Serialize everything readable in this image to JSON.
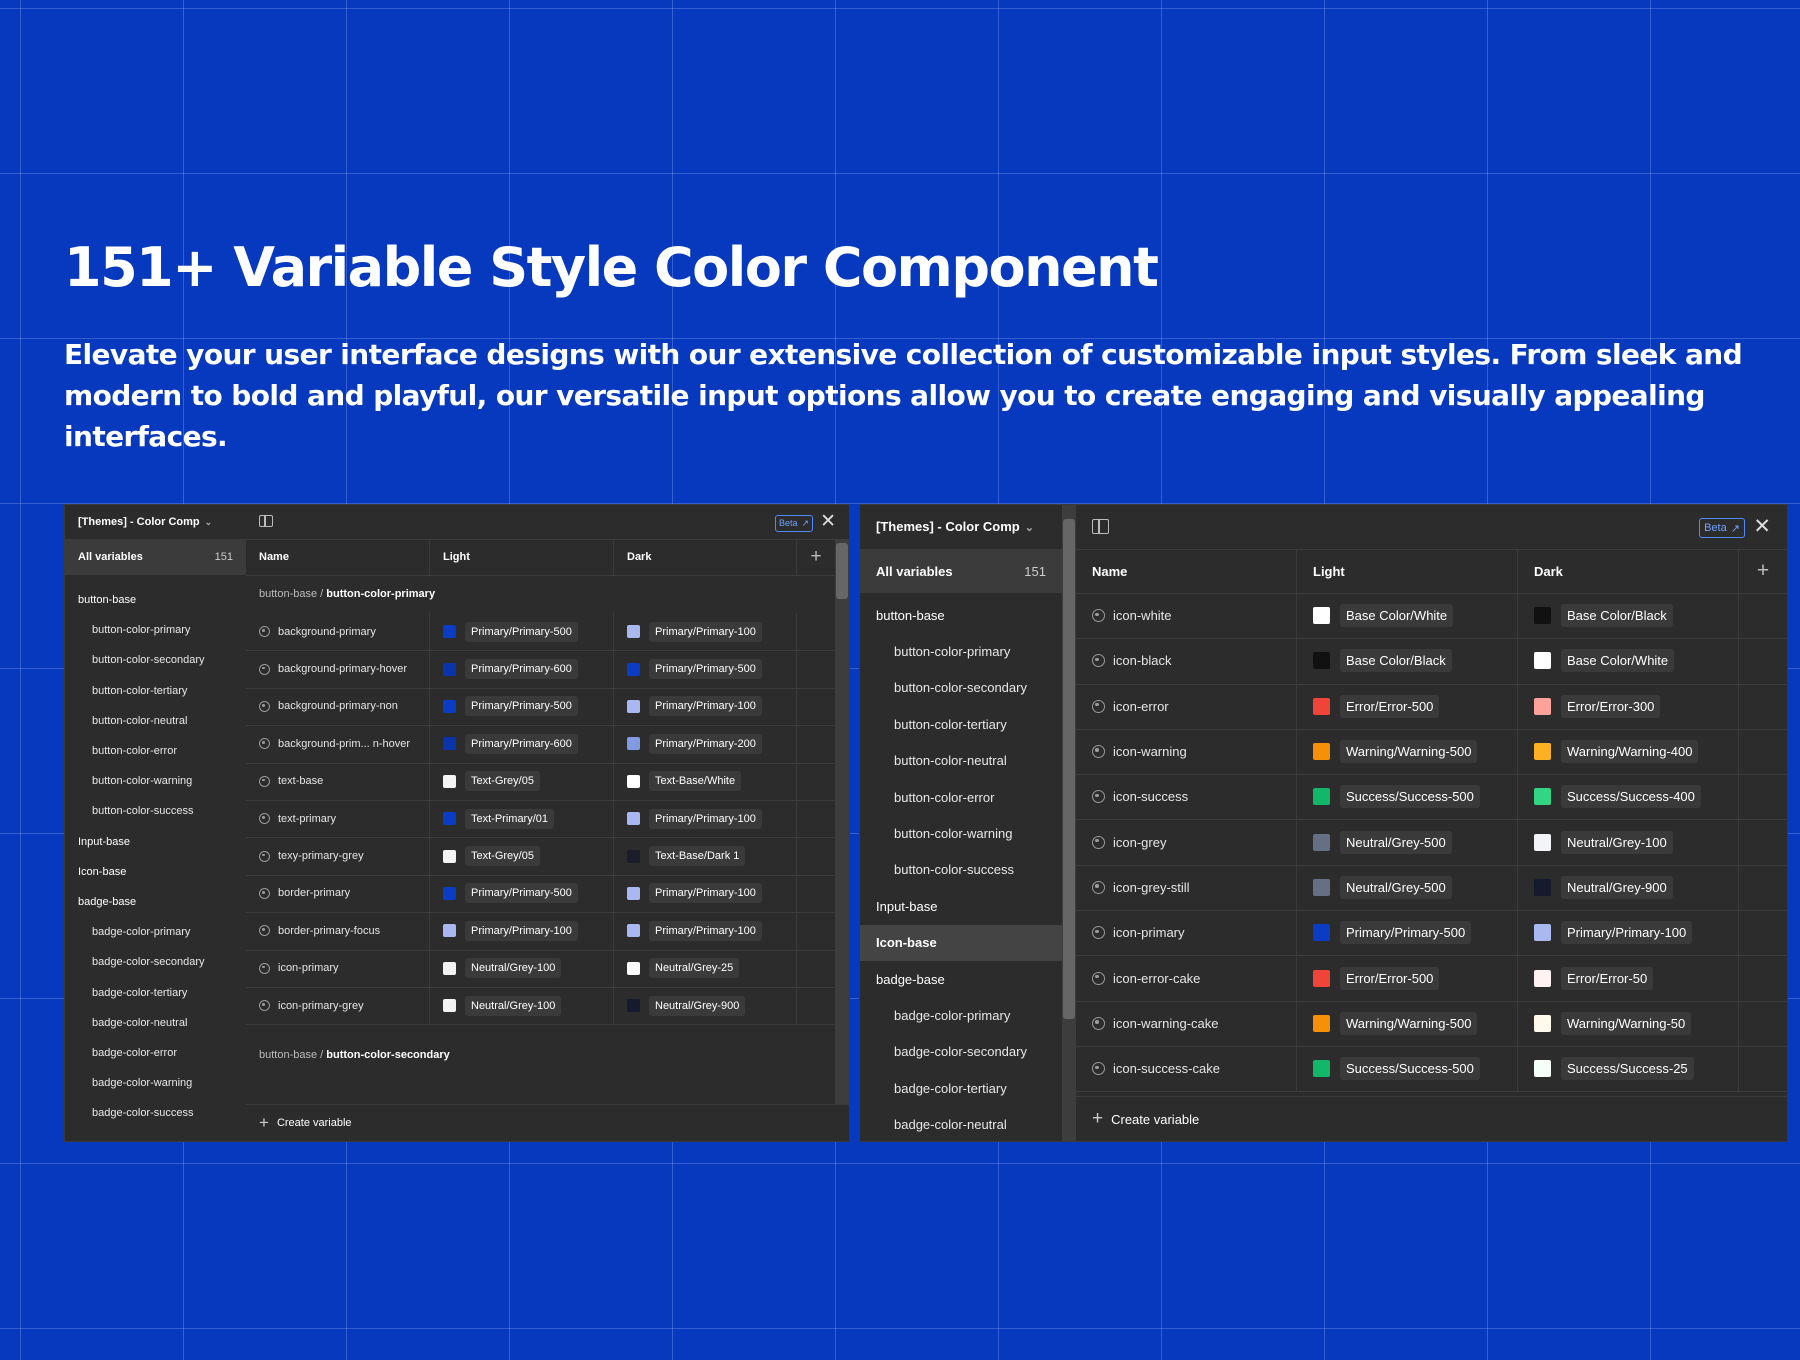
{
  "hero": {
    "title": "151+ Variable Style Color Component",
    "subtitle": "Elevate your user interface designs with our extensive collection of customizable input styles. From sleek and modern to bold and playful, our versatile input options allow you to create engaging and visually appealing interfaces."
  },
  "panel_left": {
    "collection": "[Themes] - Color Comp",
    "all_label": "All variables",
    "count": "151",
    "beta": "Beta",
    "columns": [
      "Name",
      "Light",
      "Dark"
    ],
    "create": "Create variable",
    "sidebar": [
      {
        "label": "button-base",
        "group": true
      },
      {
        "label": "button-color-primary"
      },
      {
        "label": "button-color-secondary"
      },
      {
        "label": "button-color-tertiary"
      },
      {
        "label": "button-color-neutral"
      },
      {
        "label": "button-color-error"
      },
      {
        "label": "button-color-warning"
      },
      {
        "label": "button-color-success"
      },
      {
        "label": "Input-base",
        "group": true
      },
      {
        "label": "Icon-base",
        "group": true
      },
      {
        "label": "badge-base",
        "group": true
      },
      {
        "label": "badge-color-primary"
      },
      {
        "label": "badge-color-secondary"
      },
      {
        "label": "badge-color-tertiary"
      },
      {
        "label": "badge-color-neutral"
      },
      {
        "label": "badge-color-error"
      },
      {
        "label": "badge-color-warning"
      },
      {
        "label": "badge-color-success"
      }
    ],
    "group1_prefix": "button-base / ",
    "group1_name": "button-color-primary",
    "group2_prefix": "button-base / ",
    "group2_name": "button-color-secondary",
    "rows": [
      {
        "name": "background-primary",
        "light": "Primary/Primary-500",
        "light_color": "#0B3CC4",
        "dark": "Primary/Primary-100",
        "dark_color": "#A9B8EE"
      },
      {
        "name": "background-primary-hover",
        "light": "Primary/Primary-600",
        "light_color": "#0A34AB",
        "dark": "Primary/Primary-500",
        "dark_color": "#0B3CC4"
      },
      {
        "name": "background-primary-non",
        "light": "Primary/Primary-500",
        "light_color": "#0B3CC4",
        "dark": "Primary/Primary-100",
        "dark_color": "#A9B8EE"
      },
      {
        "name": "background-prim... n-hover",
        "light": "Primary/Primary-600",
        "light_color": "#0A34AB",
        "dark": "Primary/Primary-200",
        "dark_color": "#8299E4"
      },
      {
        "name": "text-base",
        "light": "Text-Grey/05",
        "light_color": "#F4F4F4",
        "dark": "Text-Base/White",
        "dark_color": "#FFFFFF"
      },
      {
        "name": "text-primary",
        "light": "Text-Primary/01",
        "light_color": "#0B3CC4",
        "dark": "Primary/Primary-100",
        "dark_color": "#A9B8EE"
      },
      {
        "name": "texy-primary-grey",
        "light": "Text-Grey/05",
        "light_color": "#F4F4F4",
        "dark": "Text-Base/Dark 1",
        "dark_color": "#1B1D2A"
      },
      {
        "name": "border-primary",
        "light": "Primary/Primary-500",
        "light_color": "#0B3CC4",
        "dark": "Primary/Primary-100",
        "dark_color": "#A9B8EE"
      },
      {
        "name": "border-primary-focus",
        "light": "Primary/Primary-100",
        "light_color": "#A9B8EE",
        "dark": "Primary/Primary-100",
        "dark_color": "#A9B8EE"
      },
      {
        "name": "icon-primary",
        "light": "Neutral/Grey-100",
        "light_color": "#F2F2F2",
        "dark": "Neutral/Grey-25",
        "dark_color": "#FCFCFC"
      },
      {
        "name": "icon-primary-grey",
        "light": "Neutral/Grey-100",
        "light_color": "#F2F2F2",
        "dark": "Neutral/Grey-900",
        "dark_color": "#161A2E"
      }
    ]
  },
  "panel_right": {
    "collection": "[Themes] - Color Comp",
    "all_label": "All variables",
    "count": "151",
    "beta": "Beta",
    "columns": [
      "Name",
      "Light",
      "Dark"
    ],
    "create": "Create variable",
    "sidebar": [
      {
        "label": "button-base",
        "group": true
      },
      {
        "label": "button-color-primary"
      },
      {
        "label": "button-color-secondary"
      },
      {
        "label": "button-color-tertiary"
      },
      {
        "label": "button-color-neutral"
      },
      {
        "label": "button-color-error"
      },
      {
        "label": "button-color-warning"
      },
      {
        "label": "button-color-success"
      },
      {
        "label": "Input-base",
        "group": true
      },
      {
        "label": "Icon-base",
        "group": true,
        "selected": true
      },
      {
        "label": "badge-base",
        "group": true
      },
      {
        "label": "badge-color-primary"
      },
      {
        "label": "badge-color-secondary"
      },
      {
        "label": "badge-color-tertiary"
      },
      {
        "label": "badge-color-neutral"
      }
    ],
    "rows": [
      {
        "name": "icon-white",
        "light": "Base Color/White",
        "light_color": "#FFFFFF",
        "dark": "Base Color/Black",
        "dark_color": "#111111"
      },
      {
        "name": "icon-black",
        "light": "Base Color/Black",
        "light_color": "#111111",
        "dark": "Base Color/White",
        "dark_color": "#FFFFFF"
      },
      {
        "name": "icon-error",
        "light": "Error/Error-500",
        "light_color": "#F04438",
        "dark": "Error/Error-300",
        "dark_color": "#FDA29B"
      },
      {
        "name": "icon-warning",
        "light": "Warning/Warning-500",
        "light_color": "#F79009",
        "dark": "Warning/Warning-400",
        "dark_color": "#FDB022"
      },
      {
        "name": "icon-success",
        "light": "Success/Success-500",
        "light_color": "#12B76A",
        "dark": "Success/Success-400",
        "dark_color": "#32D583"
      },
      {
        "name": "icon-grey",
        "light": "Neutral/Grey-500",
        "light_color": "#667085",
        "dark": "Neutral/Grey-100",
        "dark_color": "#F2F4F7"
      },
      {
        "name": "icon-grey-still",
        "light": "Neutral/Grey-500",
        "light_color": "#667085",
        "dark": "Neutral/Grey-900",
        "dark_color": "#161A2E"
      },
      {
        "name": "icon-primary",
        "light": "Primary/Primary-500",
        "light_color": "#0B3CC4",
        "dark": "Primary/Primary-100",
        "dark_color": "#A9B8EE"
      },
      {
        "name": "icon-error-cake",
        "light": "Error/Error-500",
        "light_color": "#F04438",
        "dark": "Error/Error-50",
        "dark_color": "#FEF3F2"
      },
      {
        "name": "icon-warning-cake",
        "light": "Warning/Warning-500",
        "light_color": "#F79009",
        "dark": "Warning/Warning-50",
        "dark_color": "#FFFAEB"
      },
      {
        "name": "icon-success-cake",
        "light": "Success/Success-500",
        "light_color": "#12B76A",
        "dark": "Success/Success-25",
        "dark_color": "#F6FEF9"
      }
    ]
  }
}
